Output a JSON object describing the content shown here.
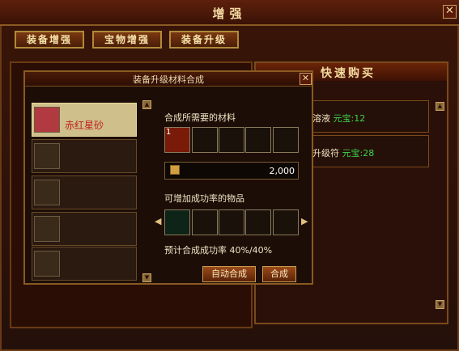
{
  "window": {
    "title": "增强",
    "close": "✕"
  },
  "tabs": [
    "装备增强",
    "宝物增强",
    "装备升级"
  ],
  "quick_buy": {
    "title": "快速购买",
    "items": [
      {
        "name": "溶液",
        "price_label": "元宝:",
        "price": "12"
      },
      {
        "name": "升级符",
        "price_label": "元宝:",
        "price": "28"
      }
    ]
  },
  "dialog": {
    "title": "装备升级材料合成",
    "close": "✕",
    "list": [
      {
        "label": "赤红星砂",
        "selected": true
      },
      {},
      {},
      {},
      {}
    ],
    "materials_heading": "合成所需要的材料",
    "material_slots": [
      {
        "count": "1",
        "filled": true
      },
      {},
      {},
      {},
      {}
    ],
    "cost": "2,000",
    "rate_items_heading": "可增加成功率的物品",
    "rate_slots": [
      {
        "filled": true
      },
      {},
      {},
      {},
      {}
    ],
    "success_rate": "预计合成成功率 40%/40%",
    "auto_button": "自动合成",
    "craft_button": "合成"
  },
  "colors": {
    "accent": "#8a5a22",
    "price_green": "#3cd34a",
    "selected_item": "#c02020"
  }
}
